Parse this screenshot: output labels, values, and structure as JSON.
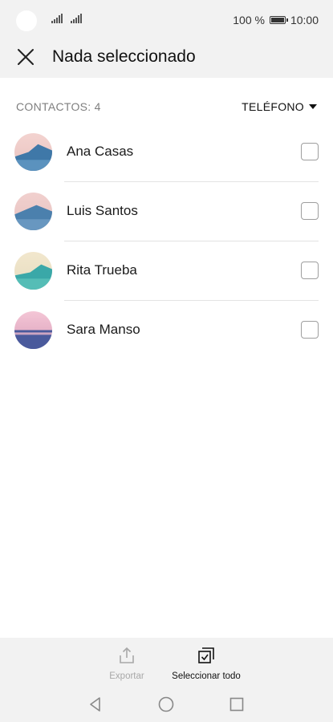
{
  "status": {
    "battery_text": "100 %",
    "time": "10:00"
  },
  "header": {
    "title": "Nada seleccionado",
    "close_icon": "close-icon"
  },
  "list": {
    "count_label": "CONTACTOS: 4",
    "filter_label": "TELÉFONO",
    "contacts": [
      {
        "name": "Ana Casas",
        "checked": false,
        "avatar_colors": [
          "#f0c8c8",
          "#3f78a8"
        ]
      },
      {
        "name": "Luis Santos",
        "checked": false,
        "avatar_colors": [
          "#efc7c5",
          "#4b80ad"
        ]
      },
      {
        "name": "Rita Trueba",
        "checked": false,
        "avatar_colors": [
          "#efe3c6",
          "#3aa8a8"
        ]
      },
      {
        "name": "Sara Manso",
        "checked": false,
        "avatar_colors": [
          "#f0b8cc",
          "#4a5a9c"
        ]
      }
    ]
  },
  "bottom_actions": {
    "export_label": "Exportar",
    "export_enabled": false,
    "select_all_label": "Seleccionar todo"
  },
  "navigation": {
    "back_icon": "back-triangle-icon",
    "home_icon": "home-circle-icon",
    "recents_icon": "recents-square-icon"
  }
}
